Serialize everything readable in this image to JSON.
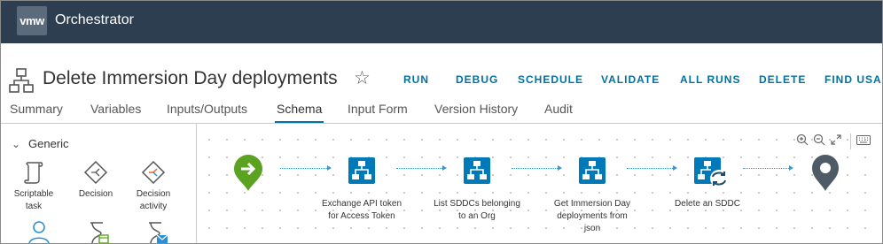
{
  "app": {
    "logo_text": "vmw",
    "title": "Orchestrator"
  },
  "header": {
    "title": "Delete Immersion Day deployments",
    "star": "☆"
  },
  "actions": [
    "RUN",
    "DEBUG",
    "SCHEDULE",
    "VALIDATE",
    "ALL RUNS",
    "DELETE",
    "FIND USA"
  ],
  "tabs": [
    "Summary",
    "Variables",
    "Inputs/Outputs",
    "Schema",
    "Input Form",
    "Version History",
    "Audit"
  ],
  "active_tab": "Schema",
  "palette": {
    "category": "Generic",
    "items": [
      {
        "label_lines": [
          "Scriptable",
          "task"
        ],
        "icon": "scroll-icon"
      },
      {
        "label_lines": [
          "Decision"
        ],
        "icon": "decision-icon"
      },
      {
        "label_lines": [
          "Decision",
          "activity"
        ],
        "icon": "decision-activity-icon"
      },
      {
        "label_lines": [],
        "icon": "user-interaction-icon"
      },
      {
        "label_lines": [],
        "icon": "waiting-timer-icon"
      },
      {
        "label_lines": [],
        "icon": "waiting-event-icon"
      }
    ]
  },
  "workflow": {
    "nodes": [
      {
        "type": "start",
        "label_lines": []
      },
      {
        "type": "workflow",
        "label_lines": [
          "Exchange API token",
          "for Access Token"
        ]
      },
      {
        "type": "workflow",
        "label_lines": [
          "List SDDCs belonging",
          "to an Org"
        ]
      },
      {
        "type": "workflow",
        "label_lines": [
          "Get Immersion Day",
          "deployments from",
          "json"
        ]
      },
      {
        "type": "foreach",
        "label_lines": [
          "Delete an SDDC"
        ]
      },
      {
        "type": "end",
        "label_lines": []
      }
    ]
  },
  "colors": {
    "topbar": "#2c3e50",
    "accent": "#0072a3",
    "start": "#5aa220",
    "node": "#0079b8",
    "end": "#4e5a66"
  }
}
